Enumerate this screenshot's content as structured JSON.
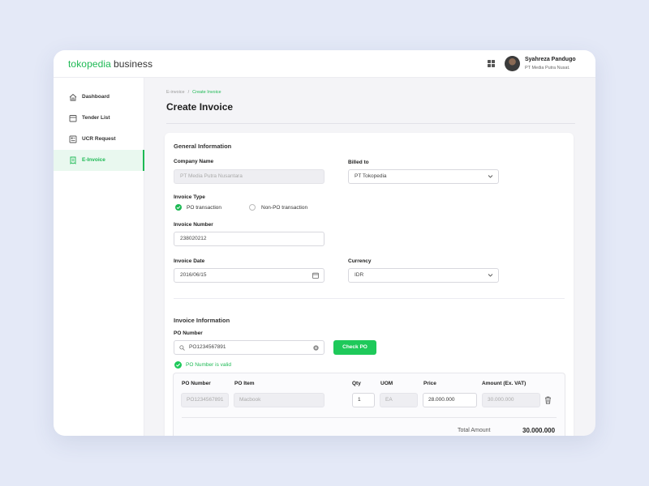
{
  "header": {
    "brand": "tokopedia",
    "brand_suffix": "business",
    "user_name": "Syahreza Pandugo",
    "user_company": "PT Media Putra Nusat.",
    "accent": "#1db954"
  },
  "sidebar": {
    "items": [
      {
        "label": "Dashboard",
        "icon": "home-icon"
      },
      {
        "label": "Tender List",
        "icon": "calendar-icon"
      },
      {
        "label": "UCR Request",
        "icon": "request-icon"
      },
      {
        "label": "E-Invoice",
        "icon": "invoice-icon",
        "active": true
      }
    ]
  },
  "breadcrumb": {
    "parent": "E-invoice",
    "separator": "/",
    "current": "Create Invoice"
  },
  "page": {
    "title": "Create Invoice"
  },
  "general": {
    "title": "General Information",
    "company_name_label": "Company Name",
    "company_name_value": "PT Media Putra Nusantara",
    "billed_to_label": "Billed to",
    "billed_to_value": "PT Tokopedia",
    "invoice_type_label": "Invoice Type",
    "po_option": "PO transaction",
    "non_po_option": "Non-PO transaction",
    "invoice_number_label": "Invoice Number",
    "invoice_number_value": "238020212",
    "invoice_date_label": "Invoice Date",
    "invoice_date_value": "2016/06/15",
    "currency_label": "Currency",
    "currency_value": "IDR"
  },
  "invoice_info": {
    "title": "Invoice Information",
    "po_number_label": "PO Number",
    "po_number_value": "PO1234567891",
    "check_button": "Check PO",
    "valid_message": "PO Number is valid"
  },
  "table": {
    "headers": [
      "PO Number",
      "PO Item",
      "Qty",
      "UOM",
      "Price",
      "Amount (Ex. VAT)"
    ],
    "row": {
      "po_number": "PO1234567891",
      "po_item": "Macbook",
      "qty": "1",
      "uom": "EA",
      "price": "28.000.000",
      "amount": "30.000.000"
    },
    "total_label": "Total Amount",
    "total_value": "30.000.000"
  }
}
